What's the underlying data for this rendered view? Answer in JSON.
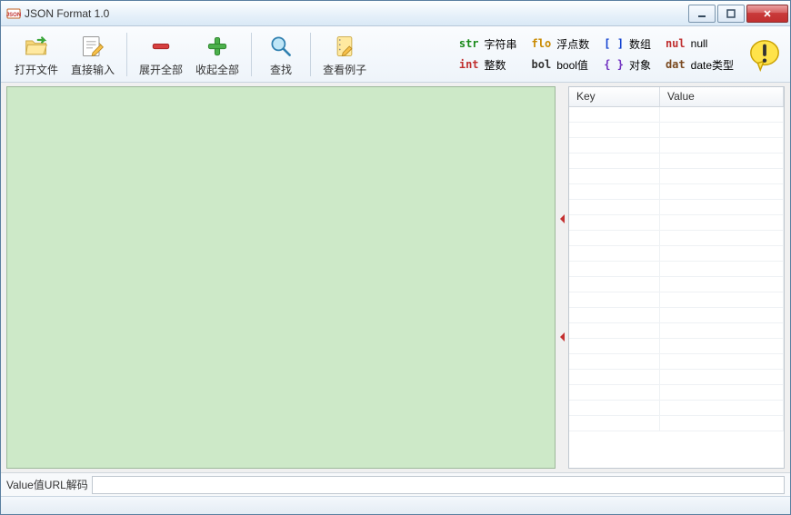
{
  "window": {
    "title": "JSON Format 1.0"
  },
  "toolbar": {
    "open_file": "打开文件",
    "direct_input": "直接输入",
    "expand_all": "展开全部",
    "collapse_all": "收起全部",
    "find": "查找",
    "view_example": "查看例子"
  },
  "legend": {
    "str": {
      "key": "str",
      "label": "字符串",
      "color": "#1a8a1a"
    },
    "flo": {
      "key": "flo",
      "label": "浮点数",
      "color": "#c98a00"
    },
    "arr": {
      "key": "[ ]",
      "label": "数组",
      "color": "#1040d0"
    },
    "nul": {
      "key": "nul",
      "label": "null",
      "color": "#c03030"
    },
    "int": {
      "key": "int",
      "label": "整数",
      "color": "#c03030"
    },
    "bol": {
      "key": "bol",
      "label": "bool值",
      "color": "#333333"
    },
    "obj": {
      "key": "{ }",
      "label": "对象",
      "color": "#7030c0"
    },
    "dat": {
      "key": "dat",
      "label": "date类型",
      "color": "#7a4a20"
    }
  },
  "table": {
    "col_key": "Key",
    "col_value": "Value"
  },
  "bottom": {
    "label": "Value值URL解码",
    "value": ""
  }
}
